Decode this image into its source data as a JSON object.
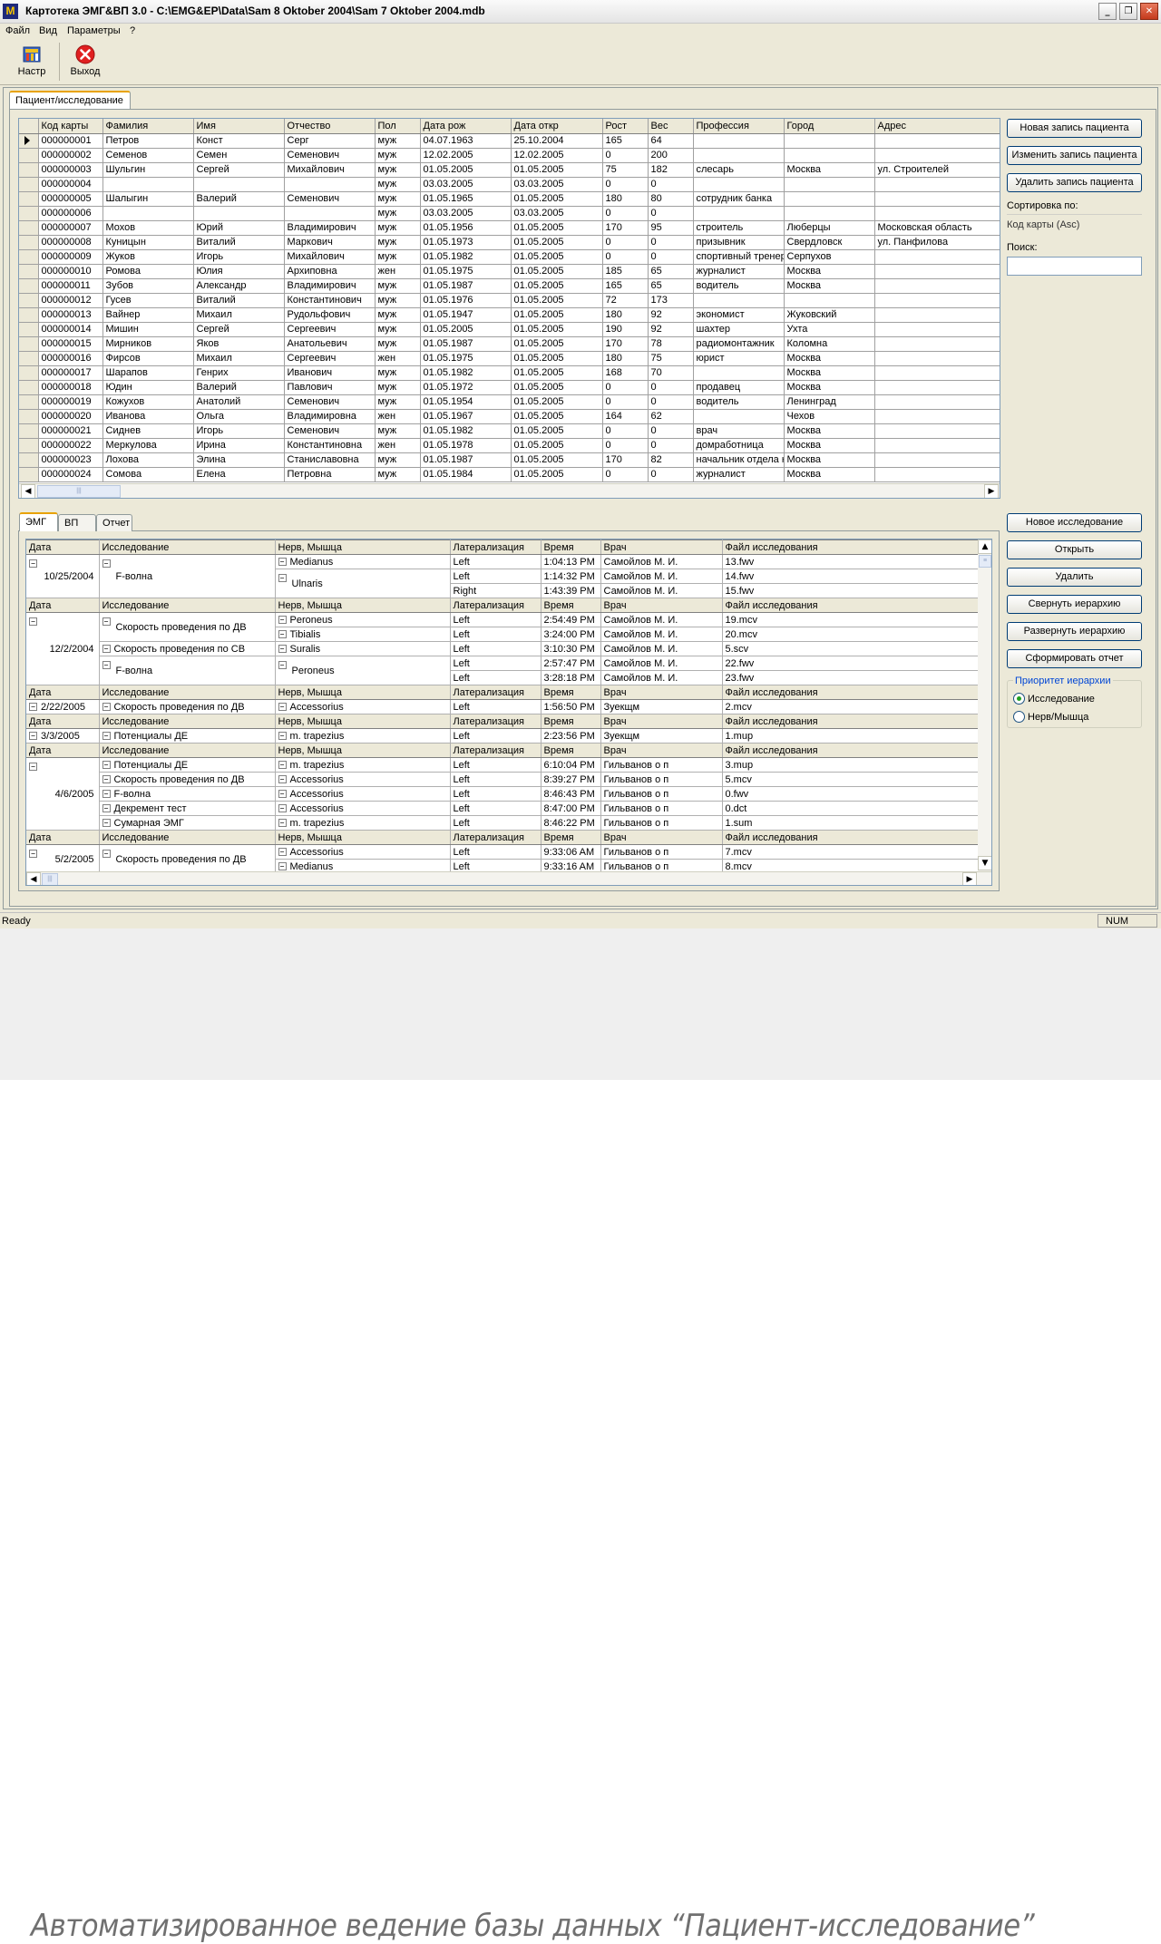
{
  "window": {
    "title": "Картотека ЭМГ&ВП 3.0 - C:\\EMG&EP\\Data\\Sam 8 Oktober 2004\\Sam 7 Oktober 2004.mdb",
    "minimize": "_",
    "maximize": "❐",
    "close": "✕"
  },
  "menu": [
    "Файл",
    "Вид",
    "Параметры",
    "?"
  ],
  "toolbar": {
    "settings": "Настр",
    "exit": "Выход",
    "settings_icon": "settings-icon",
    "exit_icon": "exit-icon",
    "exit_color": "#e02020"
  },
  "main_tab": "Пациент/исследование",
  "patients": {
    "columns": [
      "Код карты",
      "Фамилия",
      "Имя",
      "Отчество",
      "Пол",
      "Дата рож",
      "Дата откр",
      "Рост",
      "Вес",
      "Профессия",
      "Город",
      "Адрес"
    ],
    "rows": [
      [
        "000000001",
        "Петров",
        "Конст",
        "Серг",
        "муж",
        "04.07.1963",
        "25.10.2004",
        "165",
        "64",
        "",
        "",
        ""
      ],
      [
        "000000002",
        "Семенов",
        "Семен",
        "Семенович",
        "муж",
        "12.02.2005",
        "12.02.2005",
        "0",
        "200",
        "",
        "",
        ""
      ],
      [
        "000000003",
        "Шульгин",
        "Сергей",
        "Михайлович",
        "муж",
        "01.05.2005",
        "01.05.2005",
        "75",
        "182",
        "слесарь",
        "Москва",
        "ул. Строителей"
      ],
      [
        "000000004",
        "",
        "",
        "",
        "муж",
        "03.03.2005",
        "03.03.2005",
        "0",
        "0",
        "",
        "",
        ""
      ],
      [
        "000000005",
        "Шалыгин",
        "Валерий",
        "Семенович",
        "муж",
        "01.05.1965",
        "01.05.2005",
        "180",
        "80",
        "сотрудник банка",
        "",
        ""
      ],
      [
        "000000006",
        "",
        "",
        "",
        "муж",
        "03.03.2005",
        "03.03.2005",
        "0",
        "0",
        "",
        "",
        ""
      ],
      [
        "000000007",
        "Мохов",
        "Юрий",
        "Владимирович",
        "муж",
        "01.05.1956",
        "01.05.2005",
        "170",
        "95",
        "строитель",
        "Люберцы",
        "Московская область"
      ],
      [
        "000000008",
        "Куницын",
        "Виталий",
        "Маркович",
        "муж",
        "01.05.1973",
        "01.05.2005",
        "0",
        "0",
        "призывник",
        "Свердловск",
        "ул. Панфилова"
      ],
      [
        "000000009",
        "Жуков",
        "Игорь",
        "Михайлович",
        "муж",
        "01.05.1982",
        "01.05.2005",
        "0",
        "0",
        "спортивный тренер",
        "Серпухов",
        ""
      ],
      [
        "000000010",
        "Ромова",
        "Юлия",
        "Архиповна",
        "жен",
        "01.05.1975",
        "01.05.2005",
        "185",
        "65",
        "журналист",
        "Москва",
        ""
      ],
      [
        "000000011",
        "Зубов",
        "Александр",
        "Владимирович",
        "муж",
        "01.05.1987",
        "01.05.2005",
        "165",
        "65",
        "водитель",
        "Москва",
        ""
      ],
      [
        "000000012",
        "Гусев",
        "Виталий",
        "Константинович",
        "муж",
        "01.05.1976",
        "01.05.2005",
        "72",
        "173",
        "",
        "",
        ""
      ],
      [
        "000000013",
        "Вайнер",
        "Михаил",
        "Рудольфович",
        "муж",
        "01.05.1947",
        "01.05.2005",
        "180",
        "92",
        "экономист",
        "Жуковский",
        ""
      ],
      [
        "000000014",
        "Мишин",
        "Сергей",
        "Сергеевич",
        "муж",
        "01.05.2005",
        "01.05.2005",
        "190",
        "92",
        "шахтер",
        "Ухта",
        ""
      ],
      [
        "000000015",
        "Мирников",
        "Яков",
        "Анатольевич",
        "муж",
        "01.05.1987",
        "01.05.2005",
        "170",
        "78",
        "радиомонтажник",
        "Коломна",
        ""
      ],
      [
        "000000016",
        "Фирсов",
        "Михаил",
        "Сергеевич",
        "жен",
        "01.05.1975",
        "01.05.2005",
        "180",
        "75",
        "юрист",
        "Москва",
        ""
      ],
      [
        "000000017",
        "Шарапов",
        "Генрих",
        "Иванович",
        "муж",
        "01.05.1982",
        "01.05.2005",
        "168",
        "70",
        "",
        "Москва",
        ""
      ],
      [
        "000000018",
        "Юдин",
        "Валерий",
        "Павлович",
        "муж",
        "01.05.1972",
        "01.05.2005",
        "0",
        "0",
        "продавец",
        "Москва",
        ""
      ],
      [
        "000000019",
        "Кожухов",
        "Анатолий",
        "Семенович",
        "муж",
        "01.05.1954",
        "01.05.2005",
        "0",
        "0",
        "водитель",
        "Ленинград",
        ""
      ],
      [
        "000000020",
        "Иванова",
        "Ольга",
        "Владимировна",
        "жен",
        "01.05.1967",
        "01.05.2005",
        "164",
        "62",
        "",
        "Чехов",
        ""
      ],
      [
        "000000021",
        "Сиднев",
        "Игорь",
        "Семенович",
        "муж",
        "01.05.1982",
        "01.05.2005",
        "0",
        "0",
        "врач",
        "Москва",
        ""
      ],
      [
        "000000022",
        "Меркулова",
        "Ирина",
        "Константиновна",
        "жен",
        "01.05.1978",
        "01.05.2005",
        "0",
        "0",
        "домработница",
        "Москва",
        ""
      ],
      [
        "000000023",
        "Лохова",
        "Элина",
        "Станиславовна",
        "муж",
        "01.05.1987",
        "01.05.2005",
        "170",
        "82",
        "начальник отдела кадров",
        "Москва",
        ""
      ],
      [
        "000000024",
        "Сомова",
        "Елена",
        "Петровна",
        "муж",
        "01.05.1984",
        "01.05.2005",
        "0",
        "0",
        "журналист",
        "Москва",
        ""
      ]
    ]
  },
  "patient_buttons": {
    "new": "Новая запись пациента",
    "edit": "Изменить запись пациента",
    "delete": "Удалить запись пациента"
  },
  "sort": {
    "label": "Сортировка по:",
    "value": "Код карты (Asc)"
  },
  "search": {
    "label": "Поиск:",
    "value": ""
  },
  "sub_tabs": [
    "ЭМГ",
    "ВП",
    "Отчет"
  ],
  "study_columns": [
    "Дата",
    "Исследование",
    "Нерв, Мышца",
    "Латерализация",
    "Время",
    "Врач",
    "Файл исследования"
  ],
  "studies": [
    {
      "date": "10/25/2004",
      "tests": [
        {
          "name": "F-волна",
          "nerves": [
            {
              "name": "Medianus",
              "rows": [
                [
                  "Left",
                  "1:04:13 PM",
                  "Самойлов М. И.",
                  "13.fwv"
                ]
              ]
            },
            {
              "name": "Ulnaris",
              "rows": [
                [
                  "Left",
                  "1:14:32 PM",
                  "Самойлов М. И.",
                  "14.fwv"
                ],
                [
                  "Right",
                  "1:43:39 PM",
                  "Самойлов М. И.",
                  "15.fwv"
                ]
              ]
            }
          ]
        }
      ]
    },
    {
      "date": "12/2/2004",
      "tests": [
        {
          "name": "Скорость проведения по ДВ",
          "nerves": [
            {
              "name": "Peroneus",
              "rows": [
                [
                  "Left",
                  "2:54:49 PM",
                  "Самойлов М. И.",
                  "19.mcv"
                ]
              ]
            },
            {
              "name": "Tibialis",
              "rows": [
                [
                  "Left",
                  "3:24:00 PM",
                  "Самойлов М. И.",
                  "20.mcv"
                ]
              ]
            }
          ]
        },
        {
          "name": "Скорость проведения по СВ",
          "nerves": [
            {
              "name": "Suralis",
              "rows": [
                [
                  "Left",
                  "3:10:30 PM",
                  "Самойлов М. И.",
                  "5.scv"
                ]
              ]
            }
          ]
        },
        {
          "name": "F-волна",
          "nerves": [
            {
              "name": "Peroneus",
              "rows": [
                [
                  "Left",
                  "2:57:47 PM",
                  "Самойлов М. И.",
                  "22.fwv"
                ],
                [
                  "Left",
                  "3:28:18 PM",
                  "Самойлов М. И.",
                  "23.fwv"
                ]
              ]
            }
          ]
        }
      ]
    },
    {
      "date": "2/22/2005",
      "tests": [
        {
          "name": "Скорость проведения по ДВ",
          "nerves": [
            {
              "name": "Accessorius",
              "rows": [
                [
                  "Left",
                  "1:56:50 PM",
                  "Зуекщм",
                  "2.mcv"
                ]
              ]
            }
          ]
        }
      ]
    },
    {
      "date": "3/3/2005",
      "tests": [
        {
          "name": "Потенциалы ДЕ",
          "nerves": [
            {
              "name": "m. trapezius",
              "rows": [
                [
                  "Left",
                  "2:23:56 PM",
                  "Зуекщм",
                  "1.mup"
                ]
              ]
            }
          ]
        }
      ]
    },
    {
      "date": "4/6/2005",
      "tests": [
        {
          "name": "Потенциалы ДЕ",
          "nerves": [
            {
              "name": "m. trapezius",
              "rows": [
                [
                  "Left",
                  "6:10:04 PM",
                  "Гильванов о п",
                  "3.mup"
                ]
              ]
            }
          ]
        },
        {
          "name": "Скорость проведения по ДВ",
          "nerves": [
            {
              "name": "Accessorius",
              "rows": [
                [
                  "Left",
                  "8:39:27 PM",
                  "Гильванов о п",
                  "5.mcv"
                ]
              ]
            }
          ]
        },
        {
          "name": "F-волна",
          "nerves": [
            {
              "name": "Accessorius",
              "rows": [
                [
                  "Left",
                  "8:46:43 PM",
                  "Гильванов о п",
                  "0.fwv"
                ]
              ]
            }
          ]
        },
        {
          "name": "Декремент тест",
          "nerves": [
            {
              "name": "Accessorius",
              "rows": [
                [
                  "Left",
                  "8:47:00 PM",
                  "Гильванов о п",
                  "0.dct"
                ]
              ]
            }
          ]
        },
        {
          "name": "Сумарная ЭМГ",
          "nerves": [
            {
              "name": "m. trapezius",
              "rows": [
                [
                  "Left",
                  "8:46:22 PM",
                  "Гильванов о п",
                  "1.sum"
                ]
              ]
            }
          ]
        }
      ]
    },
    {
      "date": "5/2/2005",
      "tests": [
        {
          "name": "Скорость проведения по ДВ",
          "nerves": [
            {
              "name": "Accessorius",
              "rows": [
                [
                  "Left",
                  "9:33:06 AM",
                  "Гильванов о п",
                  "7.mcv"
                ]
              ]
            },
            {
              "name": "Medianus",
              "rows": [
                [
                  "Left",
                  "9:33:16 AM",
                  "Гильванов о п",
                  "8.mcv"
                ]
              ]
            }
          ]
        }
      ]
    }
  ],
  "study_buttons": {
    "new": "Новое исследование",
    "open": "Открыть",
    "delete": "Удалить",
    "collapse": "Свернуть иерархию",
    "expand": "Развернуть иерархию",
    "report": "Сформировать отчет"
  },
  "hierarchy": {
    "legend": "Приоритет иерархии",
    "option1": "Исследование",
    "option2": "Нерв/Мышца",
    "selected": "Исследование"
  },
  "status": {
    "text": "Ready",
    "num": "NUM"
  },
  "caption": "Автоматизированное ведение базы данных “Пациент-исследование”"
}
